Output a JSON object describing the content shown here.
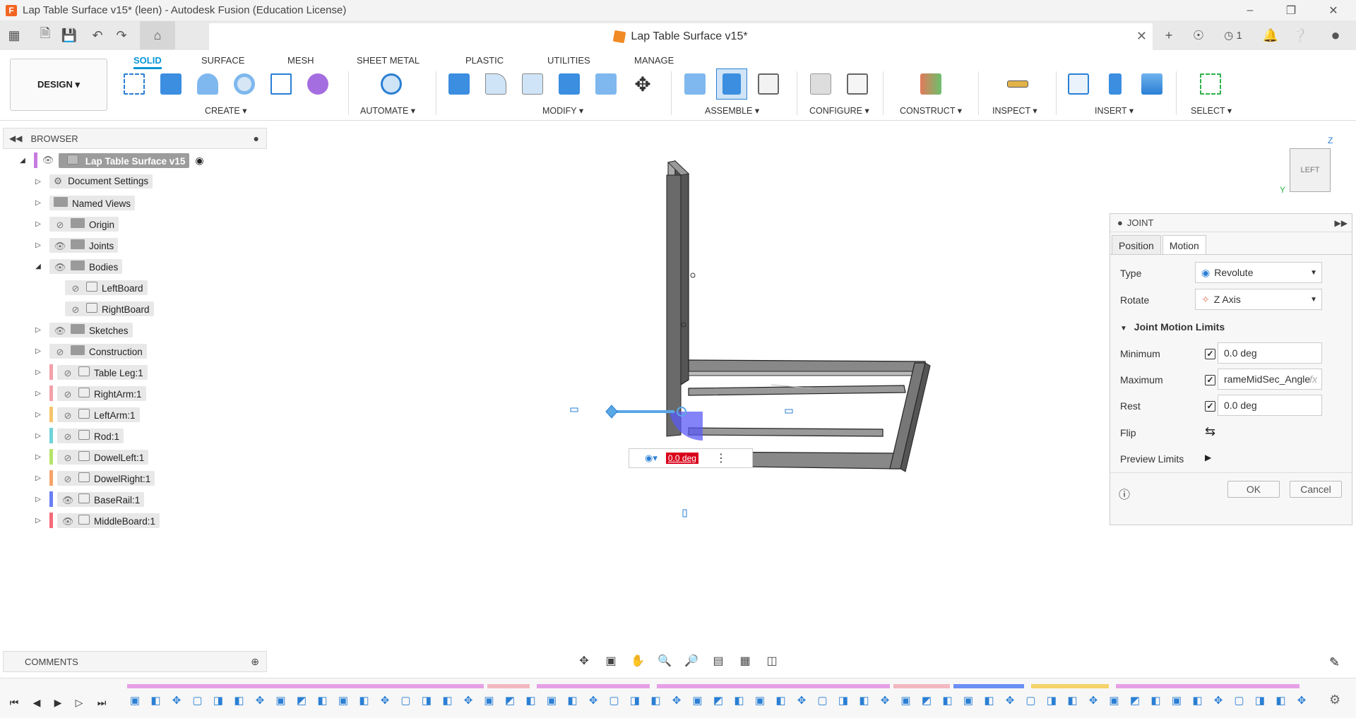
{
  "window": {
    "title": "Lap Table Surface v15* (leen) - Autodesk Fusion (Education License)"
  },
  "document": {
    "tab_title": "Lap Table Surface v15*",
    "jobs_count": "1"
  },
  "ribbon": {
    "workspace": "DESIGN ▾",
    "tabs": [
      "SOLID",
      "SURFACE",
      "MESH",
      "SHEET METAL",
      "PLASTIC",
      "UTILITIES",
      "MANAGE"
    ],
    "groups": [
      "CREATE ▾",
      "AUTOMATE ▾",
      "MODIFY ▾",
      "ASSEMBLE ▾",
      "CONFIGURE ▾",
      "CONSTRUCT ▾",
      "INSPECT ▾",
      "INSERT ▾",
      "SELECT ▾"
    ]
  },
  "browser": {
    "title": "BROWSER",
    "root": "Lap Table Surface v15",
    "items": [
      {
        "label": "Document Settings"
      },
      {
        "label": "Named Views"
      },
      {
        "label": "Origin"
      },
      {
        "label": "Joints"
      },
      {
        "label": "Bodies"
      },
      {
        "label": "LeftBoard"
      },
      {
        "label": "RightBoard"
      },
      {
        "label": "Sketches"
      },
      {
        "label": "Construction"
      },
      {
        "label": "Table Leg:1",
        "color": "#f2a0a8"
      },
      {
        "label": "RightArm:1",
        "color": "#f2a0a8"
      },
      {
        "label": "LeftArm:1",
        "color": "#f5c56a"
      },
      {
        "label": "Rod:1",
        "color": "#6fd3d8"
      },
      {
        "label": "DowelLeft:1",
        "color": "#b6e36a"
      },
      {
        "label": "DowelRight:1",
        "color": "#f5a36a"
      },
      {
        "label": "BaseRail:1",
        "color": "#6a7ef5"
      },
      {
        "label": "MiddleBoard:1",
        "color": "#f56a7a"
      }
    ]
  },
  "comments": {
    "title": "COMMENTS"
  },
  "viewcube": {
    "face": "LEFT",
    "axis_z": "Z",
    "axis_y": "Y"
  },
  "canvas": {
    "angle_input": "0.0 deg"
  },
  "joint_panel": {
    "title": "JOINT",
    "tabs": [
      "Position",
      "Motion"
    ],
    "type_label": "Type",
    "type_value": "Revolute",
    "rotate_label": "Rotate",
    "rotate_value": "Z Axis",
    "limits_header": "Joint Motion Limits",
    "minimum_label": "Minimum",
    "minimum_value": "0.0 deg",
    "maximum_label": "Maximum",
    "maximum_value": "rameMidSec_Angle",
    "fx": "fx",
    "rest_label": "Rest",
    "rest_value": "0.0 deg",
    "flip_label": "Flip",
    "preview_label": "Preview Limits",
    "ok": "OK",
    "cancel": "Cancel"
  },
  "colors": {
    "accent": "#0696d7",
    "angle_fill": "#5b5bf5",
    "input_highlight": "#d9001b"
  }
}
